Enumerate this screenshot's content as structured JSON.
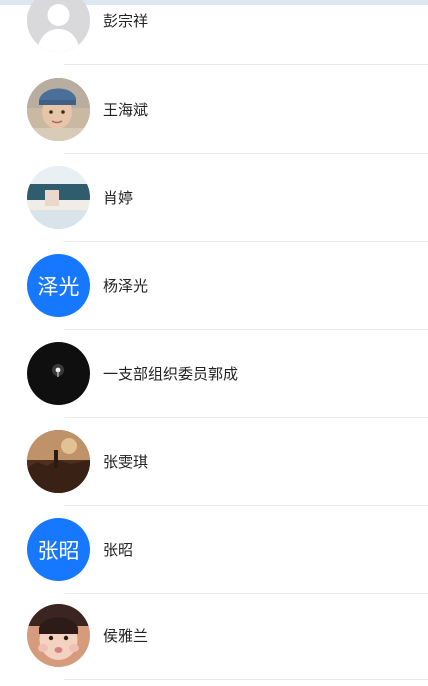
{
  "colors": {
    "accent_blue": "#1677ff",
    "text": "#222222",
    "divider": "#e9e9e9",
    "topbar": "#dde6f3"
  },
  "contacts": [
    {
      "name": "彭宗祥",
      "avatar": "default-person-icon"
    },
    {
      "name": "王海斌",
      "avatar": "child-photo"
    },
    {
      "name": "肖婷",
      "avatar": "landscape-photo"
    },
    {
      "name": "杨泽光",
      "avatar_text": "泽光"
    },
    {
      "name": "一支部组织委员郭成",
      "avatar": "dark-light-photo"
    },
    {
      "name": "张雯琪",
      "avatar": "sunset-photo"
    },
    {
      "name": "张昭",
      "avatar_text": "张昭"
    },
    {
      "name": "侯雅兰",
      "avatar": "girl-photo"
    }
  ]
}
